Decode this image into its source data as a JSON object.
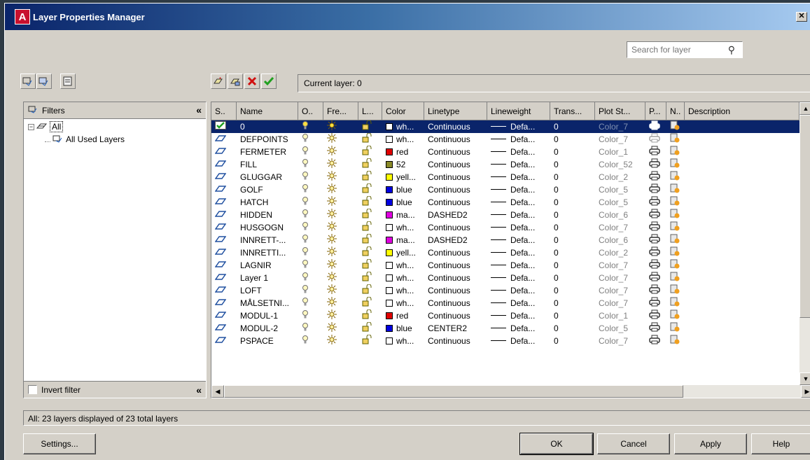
{
  "window": {
    "title": "Layer Properties Manager",
    "app_icon_letter": "A",
    "close_label": "✕"
  },
  "search": {
    "placeholder": "Search for layer"
  },
  "current_layer": "Current layer: 0",
  "filters": {
    "header": "Filters",
    "tree": [
      {
        "label": "All",
        "level": 0
      },
      {
        "label": "All Used Layers",
        "level": 1
      }
    ],
    "invert_label": "Invert filter"
  },
  "columns": [
    "S..",
    "Name",
    "O..",
    "Fre...",
    "L...",
    "Color",
    "Linetype",
    "Lineweight",
    "Trans...",
    "Plot St...",
    "P...",
    "N..",
    "Description"
  ],
  "rows": [
    {
      "name": "0",
      "color_name": "wh...",
      "color_hex": "#ffffff",
      "linetype": "Continuous",
      "lineweight": "Defa...",
      "trans": "0",
      "plot_style": "Color_7",
      "current": true
    },
    {
      "name": "DEFPOINTS",
      "color_name": "wh...",
      "color_hex": "#ffffff",
      "linetype": "Continuous",
      "lineweight": "Defa...",
      "trans": "0",
      "plot_style": "Color_7",
      "no_plot": true
    },
    {
      "name": "FERMETER",
      "color_name": "red",
      "color_hex": "#e00000",
      "linetype": "Continuous",
      "lineweight": "Defa...",
      "trans": "0",
      "plot_style": "Color_1"
    },
    {
      "name": "FILL",
      "color_name": "52",
      "color_hex": "#8a8a28",
      "linetype": "Continuous",
      "lineweight": "Defa...",
      "trans": "0",
      "plot_style": "Color_52"
    },
    {
      "name": "GLUGGAR",
      "color_name": "yell...",
      "color_hex": "#ffff00",
      "linetype": "Continuous",
      "lineweight": "Defa...",
      "trans": "0",
      "plot_style": "Color_2"
    },
    {
      "name": "GOLF",
      "color_name": "blue",
      "color_hex": "#0000e0",
      "linetype": "Continuous",
      "lineweight": "Defa...",
      "trans": "0",
      "plot_style": "Color_5"
    },
    {
      "name": "HATCH",
      "color_name": "blue",
      "color_hex": "#0000e0",
      "linetype": "Continuous",
      "lineweight": "Defa...",
      "trans": "0",
      "plot_style": "Color_5"
    },
    {
      "name": "HIDDEN",
      "color_name": "ma...",
      "color_hex": "#e000e0",
      "linetype": "DASHED2",
      "lineweight": "Defa...",
      "trans": "0",
      "plot_style": "Color_6"
    },
    {
      "name": "HUSGOGN",
      "color_name": "wh...",
      "color_hex": "#ffffff",
      "linetype": "Continuous",
      "lineweight": "Defa...",
      "trans": "0",
      "plot_style": "Color_7"
    },
    {
      "name": "INNRETT-...",
      "color_name": "ma...",
      "color_hex": "#e000e0",
      "linetype": "DASHED2",
      "lineweight": "Defa...",
      "trans": "0",
      "plot_style": "Color_6"
    },
    {
      "name": "INNRETTI...",
      "color_name": "yell...",
      "color_hex": "#ffff00",
      "linetype": "Continuous",
      "lineweight": "Defa...",
      "trans": "0",
      "plot_style": "Color_2"
    },
    {
      "name": "LAGNIR",
      "color_name": "wh...",
      "color_hex": "#ffffff",
      "linetype": "Continuous",
      "lineweight": "Defa...",
      "trans": "0",
      "plot_style": "Color_7"
    },
    {
      "name": "Layer 1",
      "color_name": "wh...",
      "color_hex": "#ffffff",
      "linetype": "Continuous",
      "lineweight": "Defa...",
      "trans": "0",
      "plot_style": "Color_7"
    },
    {
      "name": "LOFT",
      "color_name": "wh...",
      "color_hex": "#ffffff",
      "linetype": "Continuous",
      "lineweight": "Defa...",
      "trans": "0",
      "plot_style": "Color_7"
    },
    {
      "name": "MÅLSETNI...",
      "color_name": "wh...",
      "color_hex": "#ffffff",
      "linetype": "Continuous",
      "lineweight": "Defa...",
      "trans": "0",
      "plot_style": "Color_7"
    },
    {
      "name": "MODUL-1",
      "color_name": "red",
      "color_hex": "#e00000",
      "linetype": "Continuous",
      "lineweight": "Defa...",
      "trans": "0",
      "plot_style": "Color_1"
    },
    {
      "name": "MODUL-2",
      "color_name": "blue",
      "color_hex": "#0000e0",
      "linetype": "CENTER2",
      "lineweight": "Defa...",
      "trans": "0",
      "plot_style": "Color_5"
    },
    {
      "name": "PSPACE",
      "color_name": "wh...",
      "color_hex": "#ffffff",
      "linetype": "Continuous",
      "lineweight": "Defa...",
      "trans": "0",
      "plot_style": "Color_7"
    }
  ],
  "status": "All: 23 layers displayed of 23 total layers",
  "buttons": {
    "settings": "Settings...",
    "ok": "OK",
    "cancel": "Cancel",
    "apply": "Apply",
    "help": "Help"
  },
  "icons": {
    "left_toolbar": [
      "new-property-filter-icon",
      "new-group-filter-icon",
      "layer-states-manager-icon"
    ],
    "layer_toolbar": [
      "new-layer-icon",
      "new-layer-vp-frozen-icon",
      "delete-layer-icon",
      "set-current-icon"
    ]
  }
}
